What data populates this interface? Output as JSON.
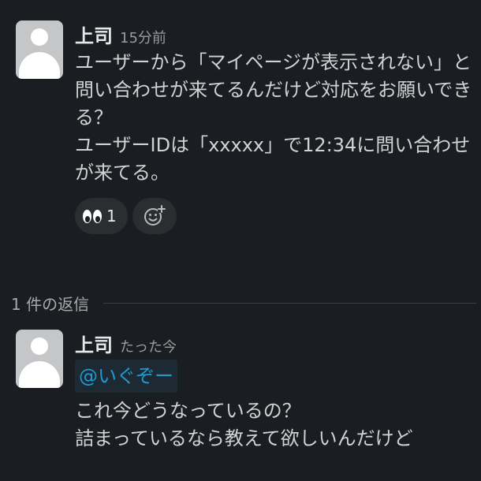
{
  "parent_message": {
    "sender": "上司",
    "time": "15分前",
    "lines": [
      "ユーザーから「マイページが表示されない」と問い合わせが来てるんだけど対応をお願いできる？",
      "ユーザーIDは「xxxxx」で12:34に問い合わせが来てる。"
    ],
    "reactions": [
      {
        "emoji": "eyes-icon",
        "count": "1"
      }
    ],
    "add_reaction_icon": "add-reaction-icon"
  },
  "thread_divider": {
    "label": "1 件の返信"
  },
  "reply_message": {
    "sender": "上司",
    "time": "たった今",
    "mention": "@いぐぞー",
    "lines": [
      "これ今どうなっているの？",
      "詰まっているなら教えて欲しいんだけど"
    ]
  },
  "colors": {
    "background": "#1a1d21",
    "text": "#d1d2d3",
    "mention_text": "#1d9bd1",
    "mention_bg": "#1d2a33",
    "pill_bg": "#2b2d31"
  }
}
